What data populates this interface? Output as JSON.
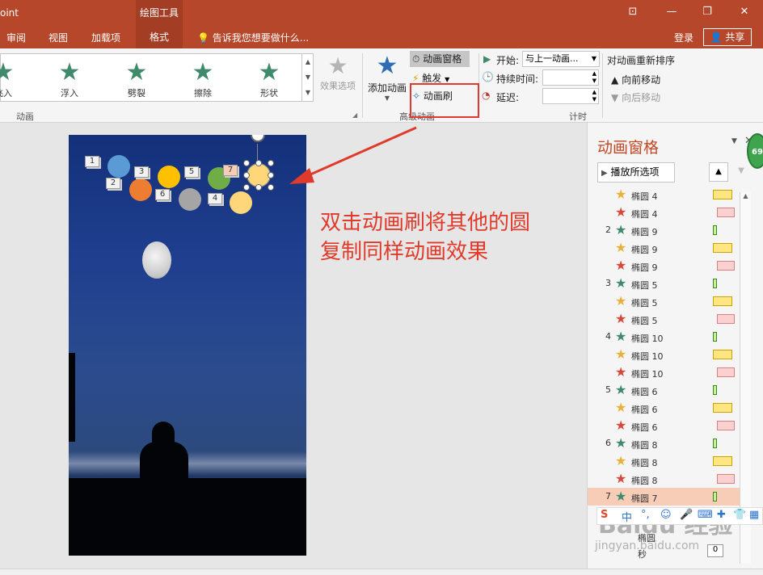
{
  "titlebar": {
    "app_title": "oint",
    "contextual_tab": "绘图工具",
    "win_ribbon": "⊡",
    "win_min": "—",
    "win_restore": "❐",
    "win_close": "✕"
  },
  "tabs": [
    "审阅",
    "视图",
    "加载项",
    "格式"
  ],
  "tellme": "告诉我您想要做什么...",
  "account": {
    "login": "登录",
    "share": "共享"
  },
  "ribbon": {
    "gallery": [
      "飞入",
      "浮入",
      "劈裂",
      "擦除",
      "形状"
    ],
    "effect_options": "效果选项",
    "group_animation": "动画",
    "add_animation": "添加动画",
    "anim_pane": "动画窗格",
    "trigger": "触发",
    "anim_brush": "动画刷",
    "group_advanced": "高级动画",
    "start_label": "开始:",
    "start_value": "与上一动画...",
    "duration_label": "持续时间:",
    "delay_label": "延迟:",
    "group_timing": "计时",
    "reorder_title": "对动画重新排序",
    "move_earlier": "向前移动",
    "move_later": "向后移动"
  },
  "slide": {
    "tags": [
      "1",
      "2",
      "3",
      "6",
      "5",
      "4",
      "7"
    ],
    "colors": {
      "blue": "#5b9bd5",
      "orange": "#ed7d31",
      "yellow": "#ffc000",
      "gray": "#a5a5a5",
      "green": "#70ad47",
      "light": "#ffd77a"
    }
  },
  "annotation": {
    "line1": "双击动画刷将其他的圆",
    "line2": "复制同样动画效果"
  },
  "pane": {
    "title": "动画窗格",
    "play_all": "播放所选项",
    "rows": [
      {
        "num": "",
        "star": "gold",
        "name": "椭圆 4",
        "bar": "yellow"
      },
      {
        "num": "",
        "star": "red",
        "name": "椭圆 4",
        "bar": "pink"
      },
      {
        "num": "2",
        "star": "green",
        "name": "椭圆 9",
        "bar": "green"
      },
      {
        "num": "",
        "star": "gold",
        "name": "椭圆 9",
        "bar": "yellow"
      },
      {
        "num": "",
        "star": "red",
        "name": "椭圆 9",
        "bar": "pink"
      },
      {
        "num": "3",
        "star": "green",
        "name": "椭圆 5",
        "bar": "green"
      },
      {
        "num": "",
        "star": "gold",
        "name": "椭圆 5",
        "bar": "yellow"
      },
      {
        "num": "",
        "star": "red",
        "name": "椭圆 5",
        "bar": "pink"
      },
      {
        "num": "4",
        "star": "green",
        "name": "椭圆 10",
        "bar": "green"
      },
      {
        "num": "",
        "star": "gold",
        "name": "椭圆 10",
        "bar": "yellow"
      },
      {
        "num": "",
        "star": "red",
        "name": "椭圆 10",
        "bar": "pink"
      },
      {
        "num": "5",
        "star": "green",
        "name": "椭圆 6",
        "bar": "green"
      },
      {
        "num": "",
        "star": "gold",
        "name": "椭圆 6",
        "bar": "yellow"
      },
      {
        "num": "",
        "star": "red",
        "name": "椭圆 6",
        "bar": "pink"
      },
      {
        "num": "6",
        "star": "green",
        "name": "椭圆 8",
        "bar": "green"
      },
      {
        "num": "",
        "star": "gold",
        "name": "椭圆 8",
        "bar": "yellow"
      },
      {
        "num": "",
        "star": "red",
        "name": "椭圆 8",
        "bar": "pink"
      },
      {
        "num": "7",
        "star": "green",
        "name": "椭圆 7",
        "bar": "green",
        "selected": true
      }
    ],
    "extra_row": "椭圆",
    "seconds": "秒",
    "seconds_value": "0"
  },
  "badge": "69",
  "ime": "中",
  "watermark": {
    "main": "Baidu 经验",
    "sub": "jingyan.baidu.com"
  }
}
